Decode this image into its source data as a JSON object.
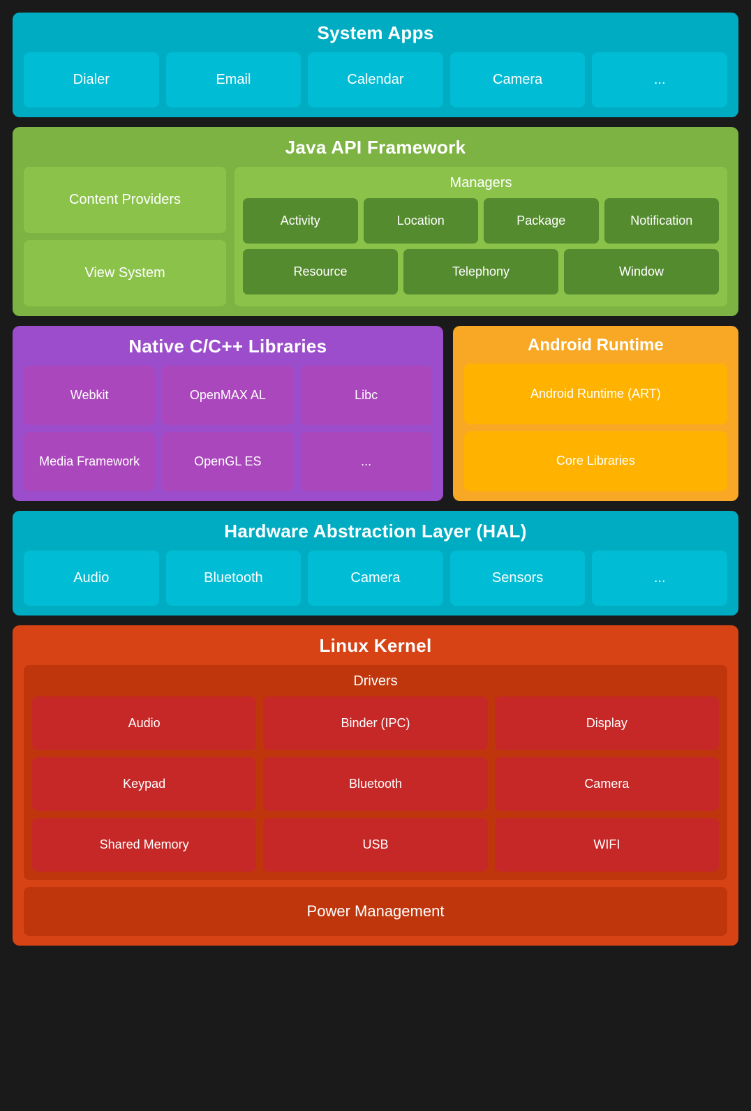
{
  "systemApps": {
    "title": "System Apps",
    "apps": [
      "Dialer",
      "Email",
      "Calendar",
      "Camera",
      "..."
    ]
  },
  "javaApi": {
    "title": "Java API Framework",
    "left": [
      "Content Providers",
      "View System"
    ],
    "managers": {
      "title": "Managers",
      "row1": [
        "Activity",
        "Location",
        "Package",
        "Notification"
      ],
      "row2": [
        "Resource",
        "Telephony",
        "Window"
      ]
    }
  },
  "nativeLibs": {
    "title": "Native C/C++ Libraries",
    "items": [
      "Webkit",
      "OpenMAX AL",
      "Libc",
      "Media Framework",
      "OpenGL ES",
      "..."
    ]
  },
  "androidRuntime": {
    "title": "Android Runtime",
    "items": [
      "Android Runtime (ART)",
      "Core Libraries"
    ]
  },
  "hal": {
    "title": "Hardware Abstraction Layer (HAL)",
    "items": [
      "Audio",
      "Bluetooth",
      "Camera",
      "Sensors",
      "..."
    ]
  },
  "linuxKernel": {
    "title": "Linux Kernel",
    "driversTitle": "Drivers",
    "drivers": [
      "Audio",
      "Binder (IPC)",
      "Display",
      "Keypad",
      "Bluetooth",
      "Camera",
      "Shared Memory",
      "USB",
      "WIFI"
    ],
    "powerManagement": "Power Management"
  }
}
